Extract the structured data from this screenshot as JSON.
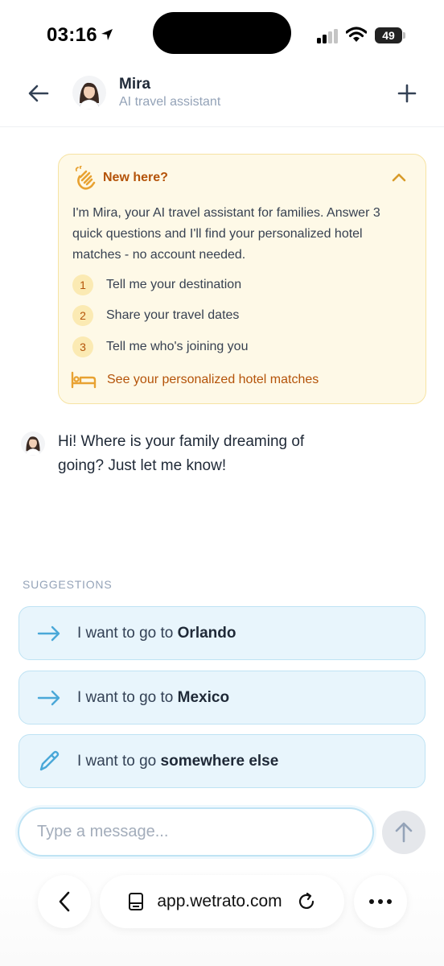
{
  "status_bar": {
    "time": "03:16",
    "battery": "49"
  },
  "header": {
    "name": "Mira",
    "subtitle": "AI travel assistant"
  },
  "welcome_card": {
    "title": "New here?",
    "intro": "I'm Mira, your AI travel assistant for families. Answer 3 quick questions and I'll find your personalized hotel matches - no account needed.",
    "steps": [
      {
        "num": "1",
        "text": "Tell me your destination"
      },
      {
        "num": "2",
        "text": "Share your travel dates"
      },
      {
        "num": "3",
        "text": "Tell me who's joining you"
      }
    ],
    "final_step": "See your personalized hotel matches"
  },
  "message": {
    "text": "Hi! Where is your family dreaming of going? Just let me know!"
  },
  "suggestions": {
    "label": "SUGGESTIONS",
    "items": [
      {
        "prefix": "I want to go to ",
        "emphasis": "Orlando",
        "icon": "arrow-right-icon"
      },
      {
        "prefix": "I want to go to ",
        "emphasis": "Mexico",
        "icon": "arrow-right-icon"
      },
      {
        "prefix": "I want to go ",
        "emphasis": "somewhere else",
        "icon": "pencil-icon"
      }
    ]
  },
  "composer": {
    "placeholder": "Type a message..."
  },
  "browser": {
    "url": "app.wetrato.com"
  },
  "colors": {
    "accent_blue": "#4aa8d8",
    "card_amber": "#b45309",
    "card_bg": "#fef9e7"
  }
}
